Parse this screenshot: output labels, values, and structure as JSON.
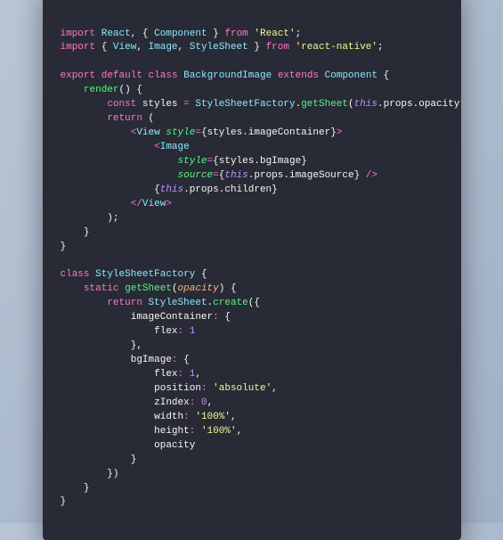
{
  "code": {
    "lines": [
      [
        {
          "c": "kw",
          "t": "import"
        },
        {
          "c": "pn",
          "t": " "
        },
        {
          "c": "cls",
          "t": "React"
        },
        {
          "c": "pn",
          "t": ", { "
        },
        {
          "c": "cls",
          "t": "Component"
        },
        {
          "c": "pn",
          "t": " } "
        },
        {
          "c": "kw",
          "t": "from"
        },
        {
          "c": "pn",
          "t": " "
        },
        {
          "c": "str",
          "t": "'React'"
        },
        {
          "c": "pn",
          "t": ";"
        }
      ],
      [
        {
          "c": "kw",
          "t": "import"
        },
        {
          "c": "pn",
          "t": " { "
        },
        {
          "c": "cls",
          "t": "View"
        },
        {
          "c": "pn",
          "t": ", "
        },
        {
          "c": "cls",
          "t": "Image"
        },
        {
          "c": "pn",
          "t": ", "
        },
        {
          "c": "cls",
          "t": "StyleSheet"
        },
        {
          "c": "pn",
          "t": " } "
        },
        {
          "c": "kw",
          "t": "from"
        },
        {
          "c": "pn",
          "t": " "
        },
        {
          "c": "str",
          "t": "'react-native'"
        },
        {
          "c": "pn",
          "t": ";"
        }
      ],
      [],
      [
        {
          "c": "kw",
          "t": "export"
        },
        {
          "c": "pn",
          "t": " "
        },
        {
          "c": "kw",
          "t": "default"
        },
        {
          "c": "pn",
          "t": " "
        },
        {
          "c": "kw",
          "t": "class"
        },
        {
          "c": "pn",
          "t": " "
        },
        {
          "c": "cls",
          "t": "BackgroundImage"
        },
        {
          "c": "pn",
          "t": " "
        },
        {
          "c": "kw",
          "t": "extends"
        },
        {
          "c": "pn",
          "t": " "
        },
        {
          "c": "cls",
          "t": "Component"
        },
        {
          "c": "pn",
          "t": " {"
        }
      ],
      [
        {
          "c": "pn",
          "t": "    "
        },
        {
          "c": "fn",
          "t": "render"
        },
        {
          "c": "pn",
          "t": "() {"
        }
      ],
      [
        {
          "c": "pn",
          "t": "        "
        },
        {
          "c": "kw",
          "t": "const"
        },
        {
          "c": "pn",
          "t": " styles "
        },
        {
          "c": "op",
          "t": "="
        },
        {
          "c": "pn",
          "t": " "
        },
        {
          "c": "cls",
          "t": "StyleSheetFactory"
        },
        {
          "c": "pn",
          "t": "."
        },
        {
          "c": "fn",
          "t": "getSheet"
        },
        {
          "c": "pn",
          "t": "("
        },
        {
          "c": "this",
          "t": "this"
        },
        {
          "c": "pn",
          "t": ".props.opacity);"
        }
      ],
      [
        {
          "c": "pn",
          "t": "        "
        },
        {
          "c": "kw",
          "t": "return"
        },
        {
          "c": "pn",
          "t": " ("
        }
      ],
      [
        {
          "c": "pn",
          "t": "            "
        },
        {
          "c": "tag",
          "t": "<"
        },
        {
          "c": "comp",
          "t": "View"
        },
        {
          "c": "pn",
          "t": " "
        },
        {
          "c": "attr",
          "t": "style"
        },
        {
          "c": "op",
          "t": "="
        },
        {
          "c": "pn",
          "t": "{styles.imageContainer}"
        },
        {
          "c": "tag",
          "t": ">"
        }
      ],
      [
        {
          "c": "pn",
          "t": "                "
        },
        {
          "c": "tag",
          "t": "<"
        },
        {
          "c": "comp",
          "t": "Image"
        }
      ],
      [
        {
          "c": "pn",
          "t": "                    "
        },
        {
          "c": "attr",
          "t": "style"
        },
        {
          "c": "op",
          "t": "="
        },
        {
          "c": "pn",
          "t": "{styles.bgImage}"
        }
      ],
      [
        {
          "c": "pn",
          "t": "                    "
        },
        {
          "c": "attr",
          "t": "source"
        },
        {
          "c": "op",
          "t": "="
        },
        {
          "c": "pn",
          "t": "{"
        },
        {
          "c": "this",
          "t": "this"
        },
        {
          "c": "pn",
          "t": ".props.imageSource} "
        },
        {
          "c": "tag",
          "t": "/>"
        }
      ],
      [
        {
          "c": "pn",
          "t": "                {"
        },
        {
          "c": "this",
          "t": "this"
        },
        {
          "c": "pn",
          "t": ".props.children}"
        }
      ],
      [
        {
          "c": "pn",
          "t": "            "
        },
        {
          "c": "tag",
          "t": "</"
        },
        {
          "c": "comp",
          "t": "View"
        },
        {
          "c": "tag",
          "t": ">"
        }
      ],
      [
        {
          "c": "pn",
          "t": "        );"
        }
      ],
      [
        {
          "c": "pn",
          "t": "    }"
        }
      ],
      [
        {
          "c": "pn",
          "t": "}"
        }
      ],
      [],
      [
        {
          "c": "kw",
          "t": "class"
        },
        {
          "c": "pn",
          "t": " "
        },
        {
          "c": "cls",
          "t": "StyleSheetFactory"
        },
        {
          "c": "pn",
          "t": " {"
        }
      ],
      [
        {
          "c": "pn",
          "t": "    "
        },
        {
          "c": "kw",
          "t": "static"
        },
        {
          "c": "pn",
          "t": " "
        },
        {
          "c": "fn",
          "t": "getSheet"
        },
        {
          "c": "pn",
          "t": "("
        },
        {
          "c": "param",
          "t": "opacity"
        },
        {
          "c": "pn",
          "t": ") {"
        }
      ],
      [
        {
          "c": "pn",
          "t": "        "
        },
        {
          "c": "kw",
          "t": "return"
        },
        {
          "c": "pn",
          "t": " "
        },
        {
          "c": "cls",
          "t": "StyleSheet"
        },
        {
          "c": "pn",
          "t": "."
        },
        {
          "c": "fn",
          "t": "create"
        },
        {
          "c": "pn",
          "t": "({"
        }
      ],
      [
        {
          "c": "pn",
          "t": "            imageContainer"
        },
        {
          "c": "op",
          "t": ":"
        },
        {
          "c": "pn",
          "t": " {"
        }
      ],
      [
        {
          "c": "pn",
          "t": "                flex"
        },
        {
          "c": "op",
          "t": ":"
        },
        {
          "c": "pn",
          "t": " "
        },
        {
          "c": "num",
          "t": "1"
        }
      ],
      [
        {
          "c": "pn",
          "t": "            },"
        }
      ],
      [
        {
          "c": "pn",
          "t": "            bgImage"
        },
        {
          "c": "op",
          "t": ":"
        },
        {
          "c": "pn",
          "t": " {"
        }
      ],
      [
        {
          "c": "pn",
          "t": "                flex"
        },
        {
          "c": "op",
          "t": ":"
        },
        {
          "c": "pn",
          "t": " "
        },
        {
          "c": "num",
          "t": "1"
        },
        {
          "c": "pn",
          "t": ","
        }
      ],
      [
        {
          "c": "pn",
          "t": "                position"
        },
        {
          "c": "op",
          "t": ":"
        },
        {
          "c": "pn",
          "t": " "
        },
        {
          "c": "str",
          "t": "'absolute'"
        },
        {
          "c": "pn",
          "t": ","
        }
      ],
      [
        {
          "c": "pn",
          "t": "                zIndex"
        },
        {
          "c": "op",
          "t": ":"
        },
        {
          "c": "pn",
          "t": " "
        },
        {
          "c": "num",
          "t": "0"
        },
        {
          "c": "pn",
          "t": ","
        }
      ],
      [
        {
          "c": "pn",
          "t": "                width"
        },
        {
          "c": "op",
          "t": ":"
        },
        {
          "c": "pn",
          "t": " "
        },
        {
          "c": "str",
          "t": "'100%'"
        },
        {
          "c": "pn",
          "t": ","
        }
      ],
      [
        {
          "c": "pn",
          "t": "                height"
        },
        {
          "c": "op",
          "t": ":"
        },
        {
          "c": "pn",
          "t": " "
        },
        {
          "c": "str",
          "t": "'100%'"
        },
        {
          "c": "pn",
          "t": ","
        }
      ],
      [
        {
          "c": "pn",
          "t": "                opacity"
        }
      ],
      [
        {
          "c": "pn",
          "t": "            }"
        }
      ],
      [
        {
          "c": "pn",
          "t": "        })"
        }
      ],
      [
        {
          "c": "pn",
          "t": "    }"
        }
      ],
      [
        {
          "c": "pn",
          "t": "}"
        }
      ]
    ]
  }
}
